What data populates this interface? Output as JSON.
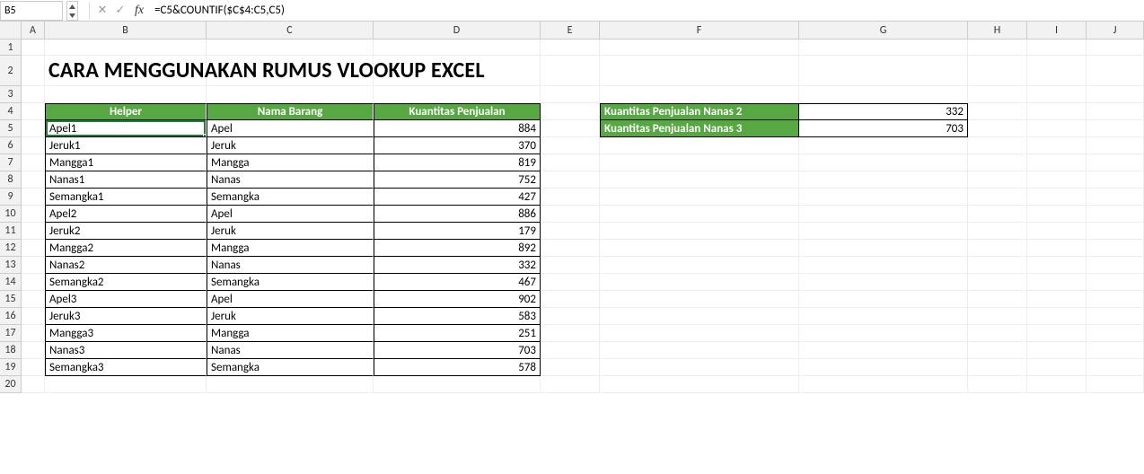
{
  "name_box": "B5",
  "formula": "=C5&COUNTIF($C$4:C5,C5)",
  "icons": {
    "cancel": "✕",
    "confirm": "✓",
    "fx": "fx",
    "up": "▲",
    "down": "▼"
  },
  "columns": [
    "A",
    "B",
    "C",
    "D",
    "E",
    "F",
    "G",
    "H",
    "I",
    "J"
  ],
  "colors": {
    "header": "#57a743",
    "selection": "#1f7e3d"
  },
  "title": "CARA MENGGUNAKAN RUMUS VLOOKUP EXCEL",
  "headers": {
    "helper": "Helper",
    "nama": "Nama Barang",
    "kuantitas": "Kuantitas Penjualan"
  },
  "data_rows": [
    {
      "helper": "Apel1",
      "nama": "Apel",
      "kuantitas": 884,
      "selected": true
    },
    {
      "helper": "Jeruk1",
      "nama": "Jeruk",
      "kuantitas": 370
    },
    {
      "helper": "Mangga1",
      "nama": "Mangga",
      "kuantitas": 819
    },
    {
      "helper": "Nanas1",
      "nama": "Nanas",
      "kuantitas": 752
    },
    {
      "helper": "Semangka1",
      "nama": "Semangka",
      "kuantitas": 427
    },
    {
      "helper": "Apel2",
      "nama": "Apel",
      "kuantitas": 886
    },
    {
      "helper": "Jeruk2",
      "nama": "Jeruk",
      "kuantitas": 179
    },
    {
      "helper": "Mangga2",
      "nama": "Mangga",
      "kuantitas": 892
    },
    {
      "helper": "Nanas2",
      "nama": "Nanas",
      "kuantitas": 332
    },
    {
      "helper": "Semangka2",
      "nama": "Semangka",
      "kuantitas": 467
    },
    {
      "helper": "Apel3",
      "nama": "Apel",
      "kuantitas": 902
    },
    {
      "helper": "Jeruk3",
      "nama": "Jeruk",
      "kuantitas": 583
    },
    {
      "helper": "Mangga3",
      "nama": "Mangga",
      "kuantitas": 251
    },
    {
      "helper": "Nanas3",
      "nama": "Nanas",
      "kuantitas": 703
    },
    {
      "helper": "Semangka3",
      "nama": "Semangka",
      "kuantitas": 578
    }
  ],
  "side": [
    {
      "label": "Kuantitas Penjualan Nanas 2",
      "value": 332
    },
    {
      "label": "Kuantitas Penjualan Nanas 3",
      "value": 703
    }
  ]
}
